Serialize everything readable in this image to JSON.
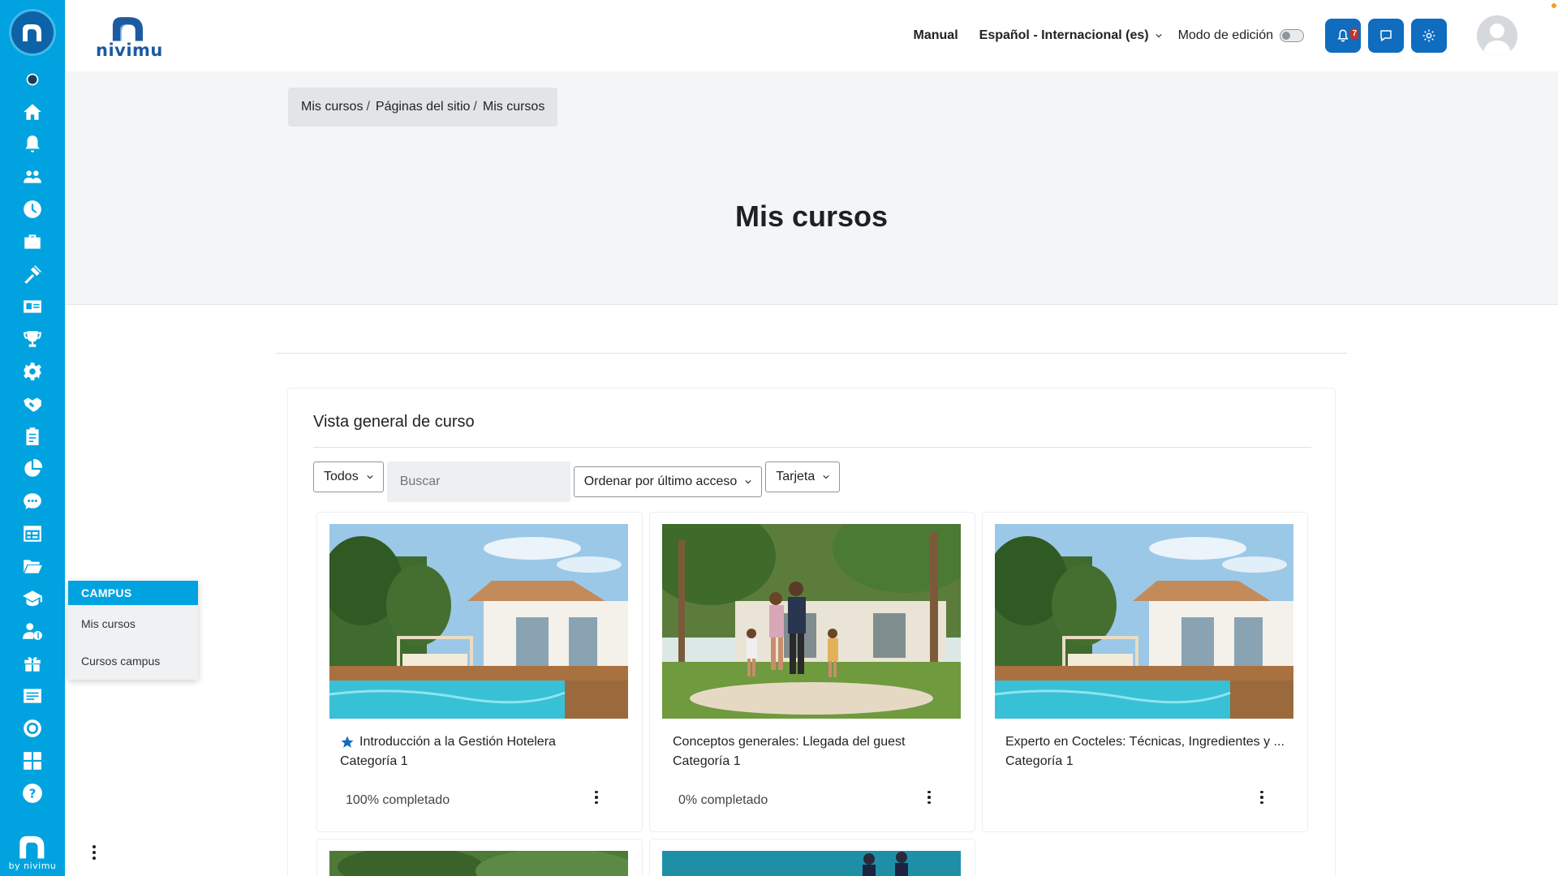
{
  "rail": {
    "icons": [
      "dot-icon",
      "home-icon",
      "bell-icon",
      "users-icon",
      "clock-icon",
      "briefcase-icon",
      "tools-icon",
      "id-card-icon",
      "trophy-icon",
      "gear-icon",
      "handshake-icon",
      "clipboard-icon",
      "pie-chart-icon",
      "chat-icon",
      "calendar-icon",
      "folder-icon",
      "graduation-cap-icon",
      "user-dollar-icon",
      "gift-icon",
      "list-icon",
      "target-icon",
      "grid-icon",
      "help-icon"
    ],
    "footer_text": "by nivimu"
  },
  "flyout": {
    "title": "CAMPUS",
    "items": [
      "Mis cursos",
      "Cursos campus"
    ]
  },
  "header": {
    "brand": "nivimu",
    "manual": "Manual",
    "language": "Español - Internacional (es)",
    "edit_mode": "Modo de edición",
    "notification_count": "7"
  },
  "breadcrumb": [
    "Mis cursos",
    "Páginas del sitio",
    "Mis cursos"
  ],
  "page_title": "Mis cursos",
  "overview": {
    "title": "Vista general de curso",
    "filter": "Todos",
    "search_placeholder": "Buscar",
    "sort": "Ordenar por último acceso",
    "view": "Tarjeta"
  },
  "courses": [
    {
      "title": "Introducción a la Gestión Hotelera",
      "category": "Categoría 1",
      "progress": "100% completado",
      "starred": true,
      "image": "pool-villa"
    },
    {
      "title": "Conceptos generales: Llegada del guest",
      "category": "Categoría 1",
      "progress": "0% completado",
      "starred": false,
      "image": "family-garden"
    },
    {
      "title": "Experto en Cocteles: Técnicas, Ingredientes y ...",
      "category": "Categoría 1",
      "progress": "",
      "starred": false,
      "image": "pool-villa"
    }
  ],
  "colors": {
    "rail": "#00a3e0",
    "primary_button": "#0f6cbf",
    "badge": "#ca3120"
  }
}
